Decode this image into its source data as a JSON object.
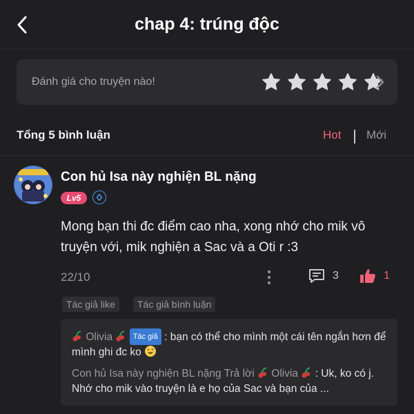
{
  "header": {
    "title": "chap 4: trúng độc",
    "back_icon": "chevron-left-icon"
  },
  "rating": {
    "prompt": "Đánh giá cho truyện nào!",
    "stars_total": 5,
    "stars_filled": 0,
    "chevron_icon": "chevron-right-icon"
  },
  "comments_section": {
    "count_label": "Tổng 5 bình luận",
    "sort_hot": "Hot",
    "sort_new": "Mới",
    "active_sort": "Hot",
    "accent_color": "#f06277"
  },
  "comment": {
    "username": "Con hủ Isa này nghiện BL nặng",
    "level": "Lv5",
    "text": "Mong bạn thi đc điểm cao nha, xong nhớ cho mik vô truyện với, mik nghiện a Sac và a Oti r :3",
    "date": "22/10",
    "reply_count": "3",
    "like_count": "1",
    "tags": [
      "Tác giả like",
      "Tác giả bình luận"
    ]
  },
  "replies": [
    {
      "author": "Olivia",
      "author_badge": "Tác giả",
      "text": ": bạn có thể cho mình một cái tên ngắn hơn để mình ghi đc ko"
    },
    {
      "author": "Con hủ Isa này nghiện BL nặng",
      "action": "Trả lời",
      "target": "Olivia",
      "text": ": Uk, ko có j. Nhớ cho mik vào truyện là e họ của Sac và bạn của ..."
    }
  ]
}
